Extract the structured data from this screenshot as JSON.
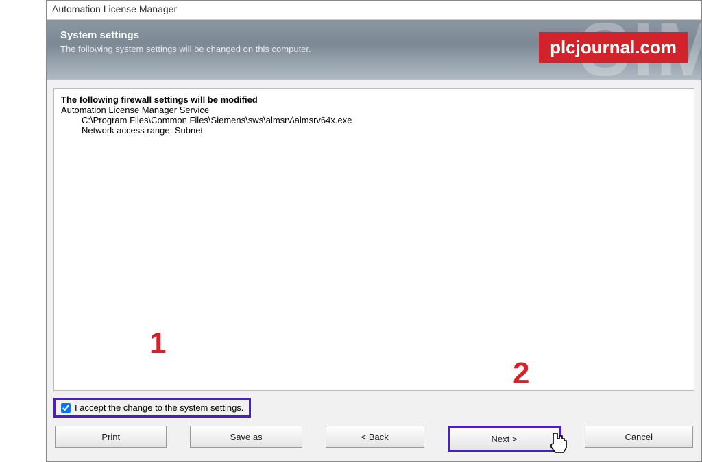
{
  "window": {
    "title": "Automation License Manager"
  },
  "header": {
    "title": "System settings",
    "subtitle": "The following system settings will be changed on this computer."
  },
  "watermark_badge": "plcjournal.com",
  "info": {
    "heading": "The following firewall settings will be modified",
    "service_line": "Automation License Manager Service",
    "path_line": "C:\\Program Files\\Common Files\\Siemens\\sws\\almsrv\\almsrv64x.exe",
    "range_line": "Network access range: Subnet"
  },
  "accept": {
    "label": "I accept the change to the system settings.",
    "checked": true
  },
  "buttons": {
    "print": "Print",
    "saveas": "Save as",
    "back": "< Back",
    "next": "Next >",
    "cancel": "Cancel"
  },
  "annotations": {
    "one": "1",
    "two": "2"
  }
}
